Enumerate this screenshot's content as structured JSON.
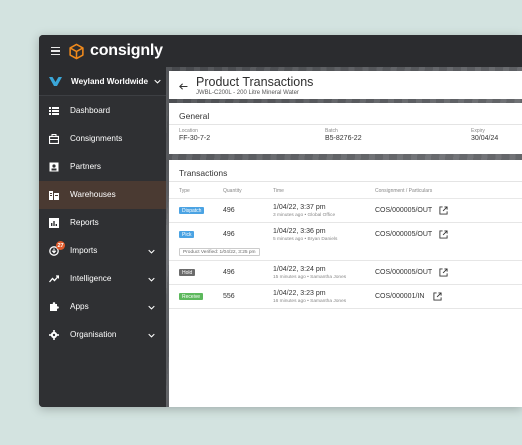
{
  "app": {
    "brand": "consignly"
  },
  "colors": {
    "accent": "#f08a1c",
    "dispatch": "#4ba3e3",
    "pick": "#4ba3e3",
    "hold": "#6b6b6b",
    "receive": "#5cb85c"
  },
  "sidebar": {
    "org_name": "Weyland Worldwide",
    "items": [
      {
        "label": "Dashboard",
        "icon": "dashboard-icon",
        "chevron": false
      },
      {
        "label": "Consignments",
        "icon": "consignments-icon",
        "chevron": false
      },
      {
        "label": "Partners",
        "icon": "partners-icon",
        "chevron": false
      },
      {
        "label": "Warehouses",
        "icon": "warehouse-icon",
        "chevron": false,
        "active": true
      },
      {
        "label": "Reports",
        "icon": "reports-icon",
        "chevron": false
      },
      {
        "label": "Imports",
        "icon": "imports-icon",
        "chevron": true,
        "badge": "27"
      },
      {
        "label": "Intelligence",
        "icon": "intelligence-icon",
        "chevron": true
      },
      {
        "label": "Apps",
        "icon": "apps-icon",
        "chevron": true
      },
      {
        "label": "Organisation",
        "icon": "gear-icon",
        "chevron": true
      }
    ]
  },
  "page": {
    "title": "Product Transactions",
    "subtitle": "JWBL-C200L - 200 Litre Mineral Water"
  },
  "general": {
    "title": "General",
    "location_label": "Location",
    "location_value": "FF-30-7-2",
    "batch_label": "Batch",
    "batch_value": "B5-8276-22",
    "expiry_label": "Expiry",
    "expiry_value": "30/04/24"
  },
  "transactions": {
    "title": "Transactions",
    "columns": {
      "type": "Type",
      "quantity": "Quantity",
      "time": "Time",
      "consignment": "Consignment / Particulars"
    },
    "rows": [
      {
        "type": "Dispatch",
        "quantity": "496",
        "time": "1/04/22, 3:37 pm",
        "time_sub": "3 minutes ago • Global Office",
        "consignment": "COS/000005/OUT"
      },
      {
        "type": "Pick",
        "quantity": "496",
        "time": "1/04/22, 3:36 pm",
        "time_sub": "5 minutes ago • Bryan Daniels",
        "consignment": "COS/000005/OUT",
        "verified": "Product Verified: 1/04/22, 3:25 pm"
      },
      {
        "type": "Hold",
        "quantity": "496",
        "time": "1/04/22, 3:24 pm",
        "time_sub": "15 minutes ago • Samantha Jones",
        "consignment": "COS/000005/OUT"
      },
      {
        "type": "Receive",
        "quantity": "556",
        "time": "1/04/22, 3:23 pm",
        "time_sub": "16 minutes ago • Samantha Jones",
        "consignment": "COS/000001/IN"
      }
    ]
  }
}
